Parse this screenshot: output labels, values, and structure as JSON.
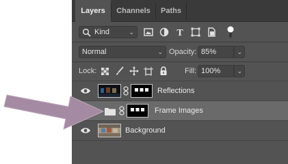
{
  "tabs": [
    {
      "label": "Layers",
      "active": true
    },
    {
      "label": "Channels",
      "active": false
    },
    {
      "label": "Paths",
      "active": false
    }
  ],
  "filter": {
    "label": "Kind"
  },
  "blend": {
    "mode": "Normal",
    "opacity_label": "Opacity:",
    "opacity_value": "85%"
  },
  "lock": {
    "label": "Lock:",
    "fill_label": "Fill:",
    "fill_value": "100%"
  },
  "layers": [
    {
      "name": "Reflections",
      "visible": true,
      "selected": false
    },
    {
      "name": "Frame Images",
      "visible": false,
      "selected": true,
      "type": "group"
    },
    {
      "name": "Background",
      "visible": true,
      "selected": false
    }
  ],
  "colors": {
    "panel": "#535353",
    "tabbar": "#3a3a3a",
    "selected_row": "#6a6a6a",
    "arrow": "#a58aa3"
  },
  "icons": [
    "search-icon",
    "image-filter-icon",
    "adjustment-filter-icon",
    "type-filter-icon",
    "shape-filter-icon",
    "smart-object-filter-icon",
    "filter-toggle-icon",
    "lock-transparent-icon",
    "lock-paint-icon",
    "lock-move-icon",
    "lock-artboard-icon",
    "lock-all-icon",
    "eye-icon",
    "folder-icon",
    "chain-link-icon",
    "pointer-arrow"
  ]
}
